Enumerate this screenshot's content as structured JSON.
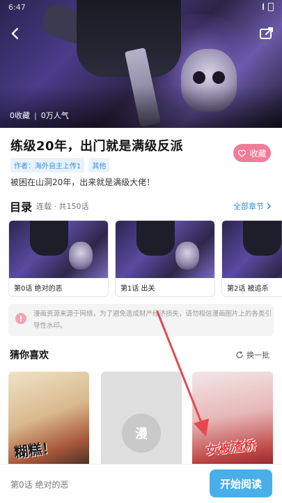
{
  "status_bar": {
    "time": "6:47"
  },
  "hero": {
    "favorites": "0收藏",
    "separator": "|",
    "popularity": "0万人气"
  },
  "comic": {
    "title": "练级20年，出门就是满级反派",
    "favorite_label": "收藏",
    "tags": [
      "作者：海外自主上传1",
      "其他"
    ],
    "description": "被困在山洞20年，出来就是满级大佬！"
  },
  "catalog": {
    "title": "目录",
    "meta": "连载 · 共150话",
    "all_chapters": "全部章节",
    "chapters": [
      {
        "label": "第0话 绝对的恶"
      },
      {
        "label": "第1话 出关"
      },
      {
        "label": "第2话 被追杀"
      }
    ]
  },
  "notice": {
    "text": "漫画资源来源于网络，为了避免造成财产经济损失，请勿相信漫画图片上的各类引导性水印。"
  },
  "recommend": {
    "title": "猜你喜欢",
    "refresh": "换一批",
    "items": [
      {
        "cover_text": "糊糕！"
      },
      {
        "placeholder": "漫"
      },
      {
        "cover_text": "女被渣桥"
      }
    ]
  },
  "bottom_bar": {
    "last_read": "第0话 绝对的恶",
    "read_button": "开始阅读"
  },
  "colors": {
    "accent_blue": "#4aaeea",
    "favorite_pink": "#f27c97",
    "annotation_red": "#e8474f"
  }
}
